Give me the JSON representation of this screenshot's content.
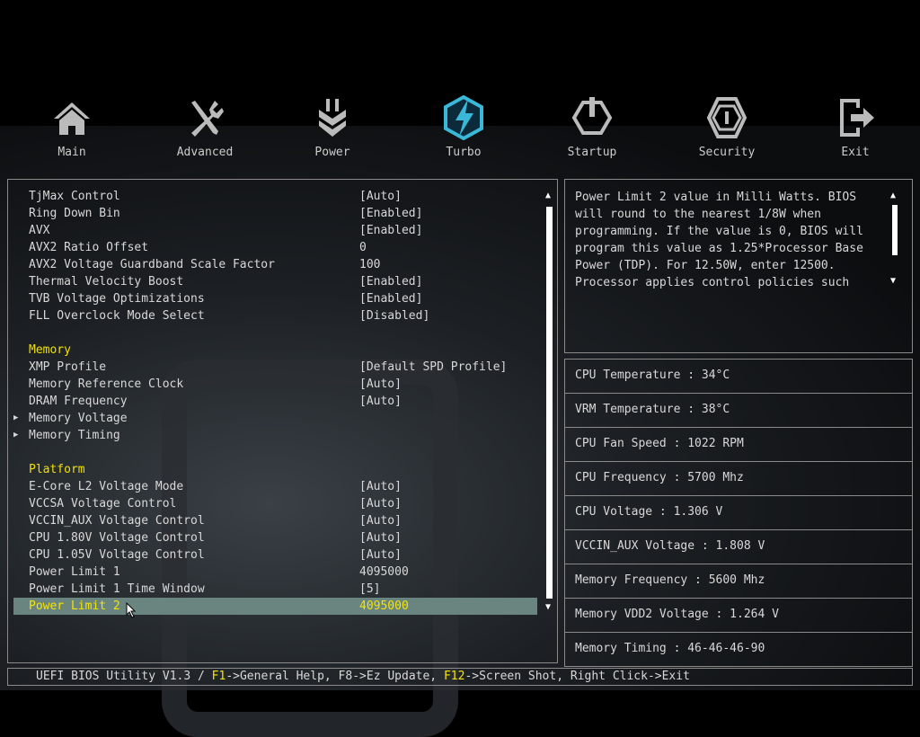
{
  "nav": [
    {
      "label": "Main",
      "icon": "home-icon"
    },
    {
      "label": "Advanced",
      "icon": "tools-icon"
    },
    {
      "label": "Power",
      "icon": "plug-icon"
    },
    {
      "label": "Turbo",
      "icon": "turbo-bolt-icon"
    },
    {
      "label": "Startup",
      "icon": "power-icon"
    },
    {
      "label": "Security",
      "icon": "shield-icon"
    },
    {
      "label": "Exit",
      "icon": "exit-icon"
    }
  ],
  "settings": [
    {
      "label": "TjMax Control",
      "value": "[Auto]"
    },
    {
      "label": "Ring Down Bin",
      "value": "[Enabled]"
    },
    {
      "label": "AVX",
      "value": "[Enabled]"
    },
    {
      "label": "AVX2 Ratio Offset",
      "value": "0"
    },
    {
      "label": "AVX2 Voltage Guardband Scale Factor",
      "value": "100"
    },
    {
      "label": "Thermal Velocity Boost",
      "value": "[Enabled]"
    },
    {
      "label": "TVB Voltage Optimizations",
      "value": "[Enabled]"
    },
    {
      "label": "FLL Overclock Mode Select",
      "value": "[Disabled]"
    },
    {
      "label": "",
      "value": ""
    },
    {
      "label": "Memory",
      "value": "",
      "section": true
    },
    {
      "label": "XMP Profile",
      "value": "[Default SPD Profile]"
    },
    {
      "label": "Memory Reference Clock",
      "value": "[Auto]"
    },
    {
      "label": "DRAM Frequency",
      "value": "[Auto]"
    },
    {
      "label": "Memory Voltage",
      "value": "",
      "submenu": true
    },
    {
      "label": "Memory Timing",
      "value": "",
      "submenu": true
    },
    {
      "label": "",
      "value": ""
    },
    {
      "label": "Platform",
      "value": "",
      "section": true
    },
    {
      "label": "E-Core L2 Voltage Mode",
      "value": "[Auto]"
    },
    {
      "label": "VCCSA Voltage Control",
      "value": "[Auto]"
    },
    {
      "label": "VCCIN_AUX Voltage Control",
      "value": "[Auto]"
    },
    {
      "label": "CPU 1.80V Voltage Control",
      "value": "[Auto]"
    },
    {
      "label": "CPU 1.05V Voltage Control",
      "value": "[Auto]"
    },
    {
      "label": "Power Limit 1",
      "value": "4095000"
    },
    {
      "label": "Power Limit 1 Time Window",
      "value": "[5]"
    },
    {
      "label": "Power Limit 2",
      "value": "4095000",
      "selected": true
    }
  ],
  "help_text": "Power Limit 2 value in Milli Watts. BIOS\nwill round to the nearest 1/8W when\nprogramming. If the value is 0, BIOS will\nprogram this value as 1.25*Processor Base\nPower (TDP). For 12.50W, enter 12500.\nProcessor applies control policies such",
  "stats": [
    "CPU Temperature : 34°C",
    "VRM Temperature : 38°C",
    "CPU Fan Speed : 1022 RPM",
    "CPU Frequency : 5700 Mhz",
    "CPU Voltage : 1.306 V",
    "VCCIN_AUX Voltage : 1.808 V",
    "Memory Frequency : 5600 Mhz",
    "Memory VDD2 Voltage : 1.264 V",
    "Memory Timing : 46-46-46-90"
  ],
  "footer": {
    "prefix": "UEFI BIOS Utility V1.3 / ",
    "f1": "F1",
    "f1_text": "->General Help, F8->Ez Update, ",
    "f12": "F12",
    "f12_text": "->Screen Shot, Right Click->Exit"
  },
  "colors": {
    "accent": "#f5e400",
    "selected_bg": "#6a8580",
    "turbo": "#3ab8d8"
  }
}
